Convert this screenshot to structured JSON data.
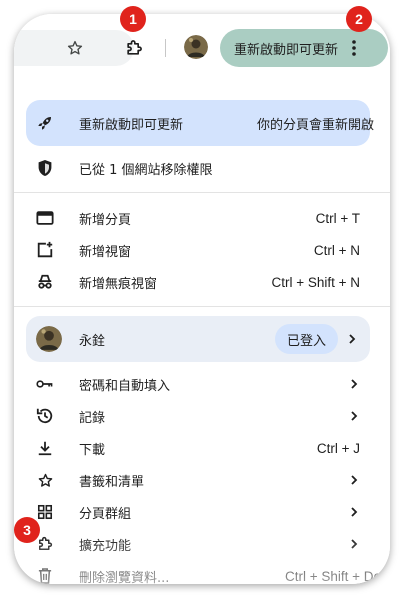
{
  "toolbar": {
    "restart_pill_label": "重新啟動即可更新",
    "icons": [
      "star-icon",
      "extensions-puzzle-icon",
      "profile-avatar",
      "kebab-menu-icon"
    ]
  },
  "menu": {
    "update_banner": {
      "label": "重新啟動即可更新",
      "note": "你的分頁會重新開啟"
    },
    "permission_item": {
      "label": "已從 1 個網站移除權限"
    },
    "new_tab": {
      "label": "新增分頁",
      "shortcut": "Ctrl + T"
    },
    "new_window": {
      "label": "新增視窗",
      "shortcut": "Ctrl + N"
    },
    "new_incognito": {
      "label": "新增無痕視窗",
      "shortcut": "Ctrl + Shift + N"
    },
    "profile": {
      "name": "永銓",
      "status": "已登入"
    },
    "passwords": {
      "label": "密碼和自動填入"
    },
    "history": {
      "label": "記錄"
    },
    "downloads": {
      "label": "下載",
      "shortcut": "Ctrl + J"
    },
    "bookmarks": {
      "label": "書籤和清單"
    },
    "tab_groups": {
      "label": "分頁群組"
    },
    "extensions": {
      "label": "擴充功能"
    },
    "clear_data": {
      "label": "刪除瀏覽資料...",
      "shortcut": "Ctrl + Shift + Del"
    }
  },
  "annotations": {
    "badge1": "1",
    "badge2": "2",
    "badge3": "3"
  },
  "colors": {
    "accent_blue": "#d3e3fd",
    "restart_pill": "#aacdc2",
    "badge_red": "#e0231c"
  }
}
